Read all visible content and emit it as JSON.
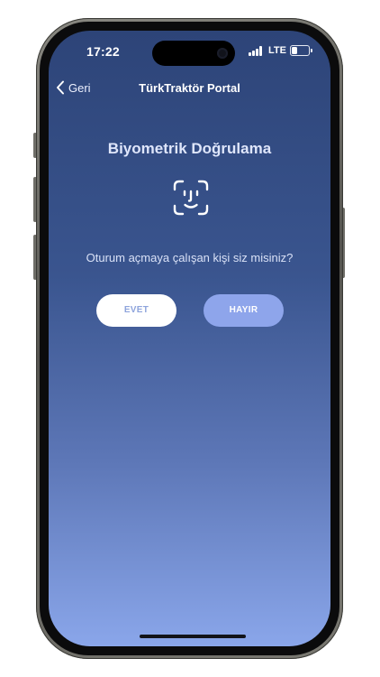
{
  "status_bar": {
    "time": "17:22",
    "network": "LTE",
    "signal_icon": "cellular-signal-icon",
    "battery_icon": "battery-icon",
    "battery_level": 0.35
  },
  "nav": {
    "back_label": "Geri",
    "back_icon": "chevron-left-icon",
    "title": "TürkTraktör Portal"
  },
  "biometric": {
    "heading": "Biyometrik Doğrulama",
    "icon": "face-id-icon",
    "prompt": "Oturum açmaya çalışan kişi siz misiniz?",
    "yes_label": "EVET",
    "no_label": "HAYIR"
  },
  "colors": {
    "background_top": "#2d4478",
    "background_bottom": "#8aa6ea",
    "yes_button_bg": "#ffffff",
    "no_button_bg": "#8ea5eb"
  }
}
